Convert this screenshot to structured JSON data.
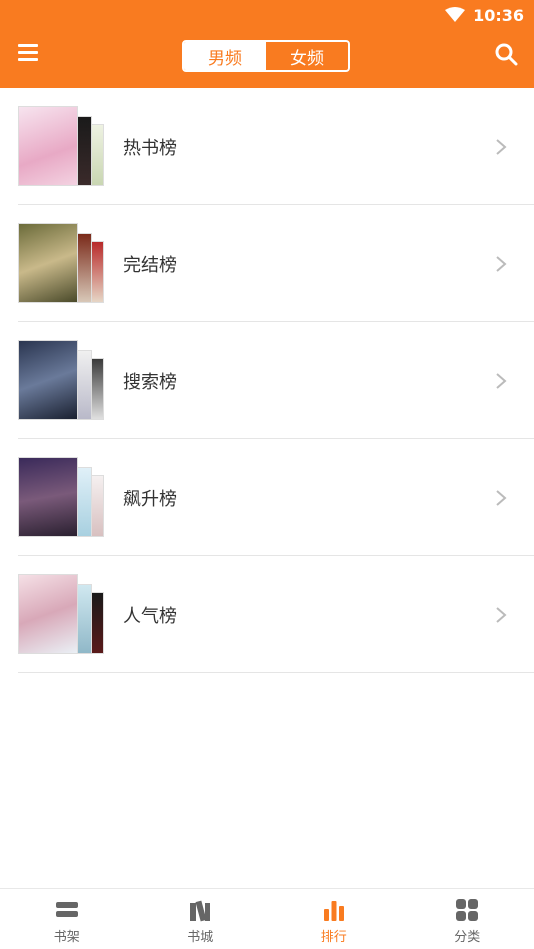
{
  "status_bar": {
    "time": "10:36"
  },
  "header": {
    "tabs": [
      {
        "label": "男频",
        "active": true
      },
      {
        "label": "女频",
        "active": false
      }
    ]
  },
  "rankings": [
    {
      "label": "热书榜"
    },
    {
      "label": "完结榜"
    },
    {
      "label": "搜索榜"
    },
    {
      "label": "飙升榜"
    },
    {
      "label": "人气榜"
    }
  ],
  "bottom_nav": [
    {
      "label": "书架",
      "icon": "bookshelf-icon"
    },
    {
      "label": "书城",
      "icon": "bookstore-icon"
    },
    {
      "label": "排行",
      "icon": "ranking-icon",
      "active": true
    },
    {
      "label": "分类",
      "icon": "category-icon"
    }
  ],
  "colors": {
    "accent": "#f97b20"
  }
}
